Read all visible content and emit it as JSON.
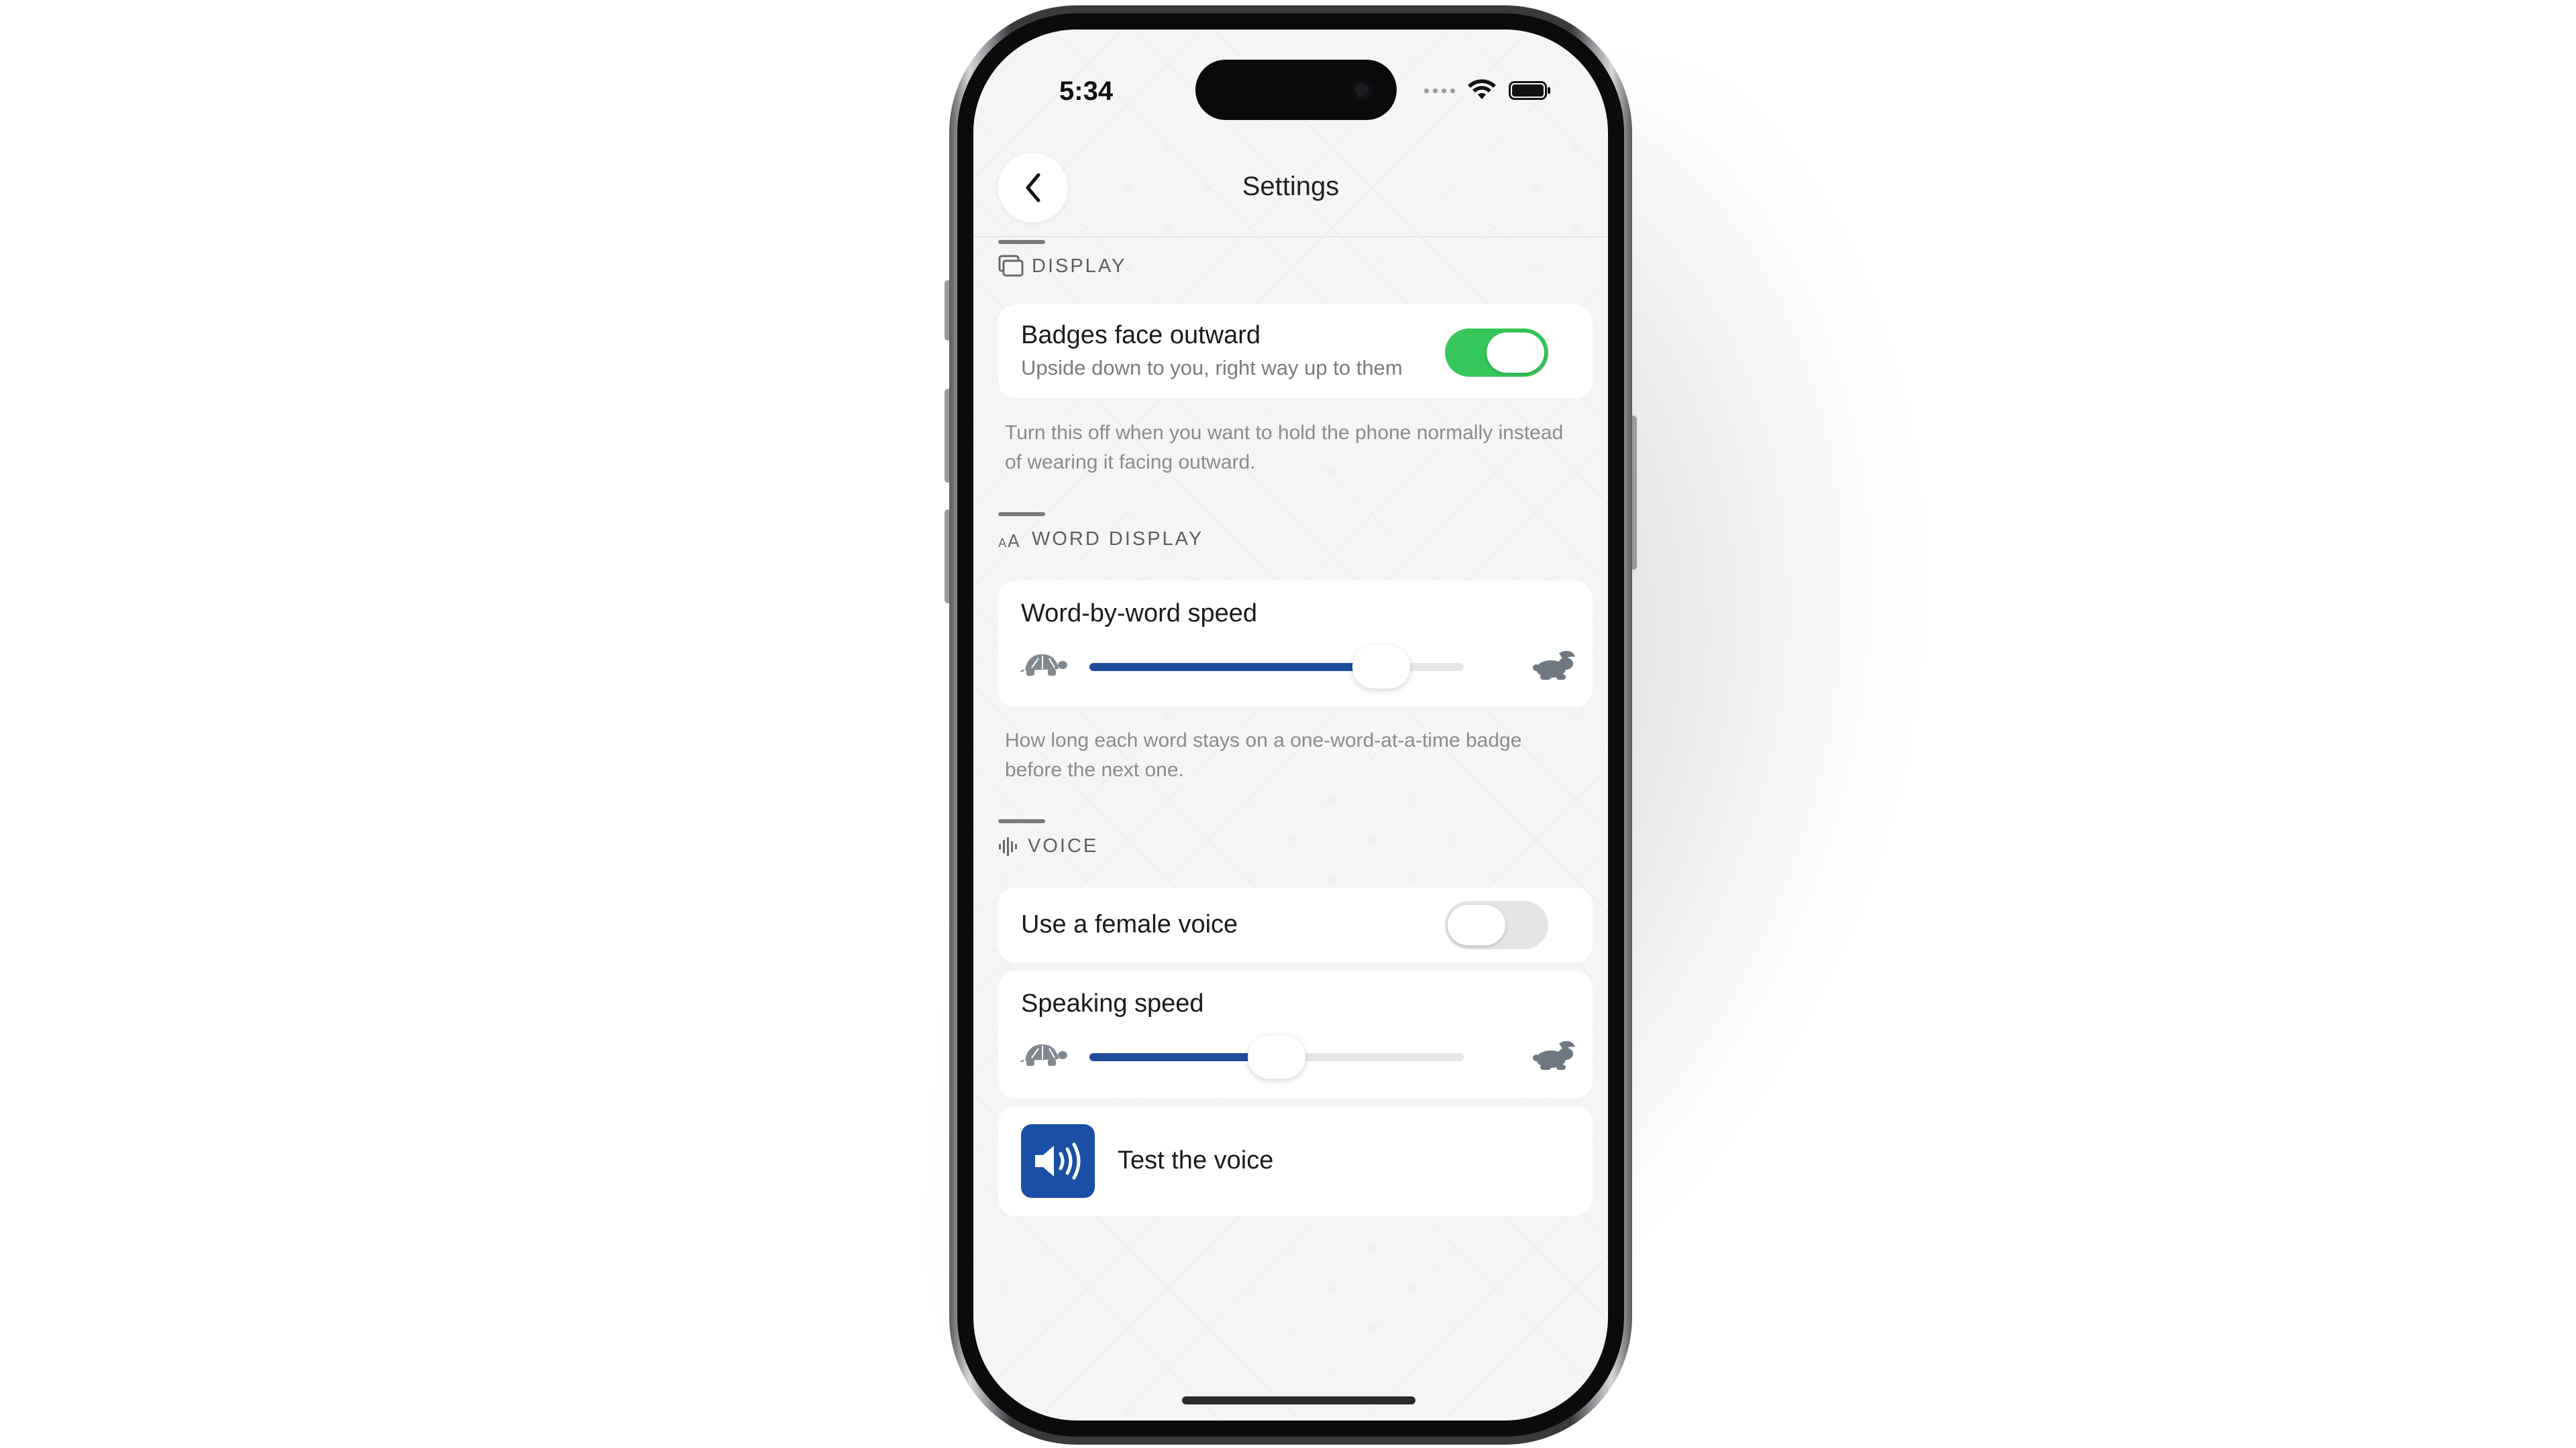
{
  "status_bar": {
    "time": "5:34"
  },
  "nav": {
    "title": "Settings",
    "back_icon": "chevron-left-icon"
  },
  "display_section": {
    "header": "DISPLAY",
    "icon": "display-icon",
    "badges_toggle": {
      "title": "Badges face outward",
      "subtitle": "Upside down to you, right way up to them",
      "on": true
    },
    "note": "Turn this off when you want to hold the phone normally instead of wearing it facing outward."
  },
  "word_display_section": {
    "header": "WORD DISPLAY",
    "icon": "text-size-icon",
    "speed": {
      "title": "Word-by-word speed",
      "value": 0.78
    },
    "note": "How long each word stays on a one-word-at-a-time badge before the next one."
  },
  "voice_section": {
    "header": "VOICE",
    "icon": "waveform-icon",
    "female_voice": {
      "title": "Use a female voice",
      "on": false
    },
    "speaking_speed": {
      "title": "Speaking speed",
      "value": 0.5
    },
    "test_voice": {
      "label": "Test the voice",
      "icon": "speaker-icon"
    }
  },
  "colors": {
    "accent": "#1e4d9c",
    "toggle_on": "#35c759",
    "background": "#f6f5f3"
  }
}
